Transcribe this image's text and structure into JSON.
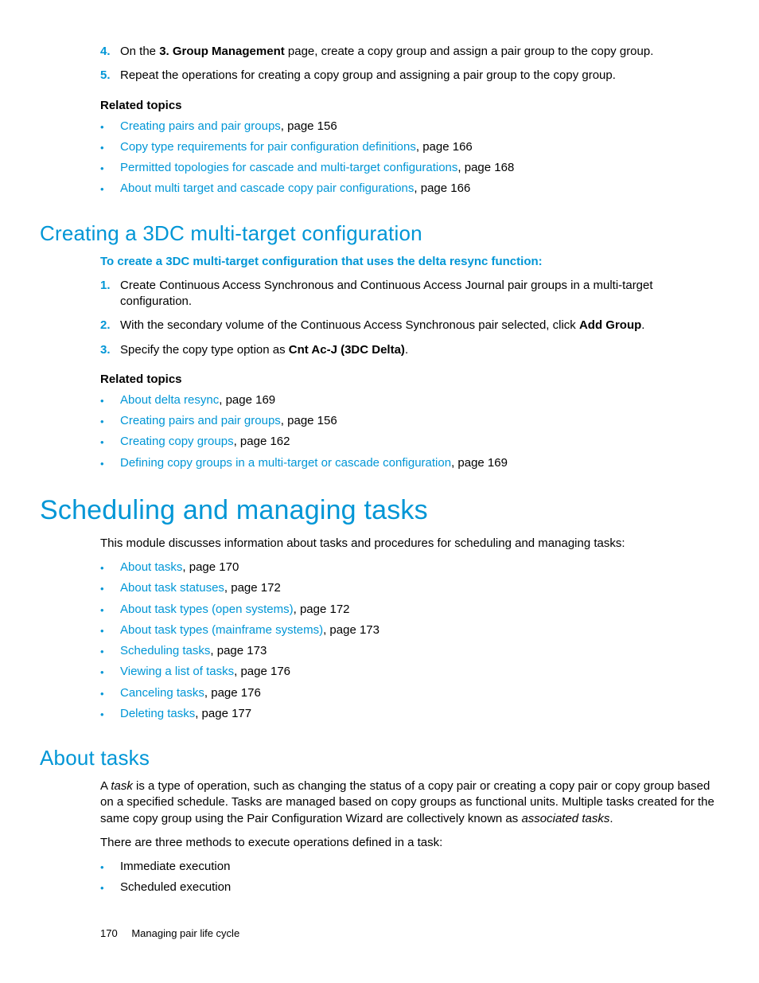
{
  "topSteps": [
    {
      "num": "4.",
      "pre": "On the ",
      "bold": "3. Group Management",
      "post": " page, create a copy group and assign a pair group to the copy group."
    },
    {
      "num": "5.",
      "pre": "Repeat the operations for creating a copy group and assigning a pair group to the copy group.",
      "bold": "",
      "post": ""
    }
  ],
  "related1": {
    "heading": "Related topics",
    "items": [
      {
        "link": "Creating pairs and pair groups",
        "suffix": ", page 156"
      },
      {
        "link": "Copy type requirements for pair configuration definitions",
        "suffix": ", page 166"
      },
      {
        "link": "Permitted topologies for cascade and multi-target configurations",
        "suffix": ", page 168"
      },
      {
        "link": "About multi target and cascade copy pair configurations",
        "suffix": ", page 166"
      }
    ]
  },
  "h2_1": "Creating a 3DC multi-target configuration",
  "intro1": "To create a 3DC multi-target configuration that uses the delta resync function:",
  "steps2": [
    {
      "num": "1.",
      "text": "Create Continuous Access Synchronous and Continuous Access Journal pair groups in a multi-target configuration."
    },
    {
      "num": "2.",
      "pre": "With the secondary volume of the Continuous Access Synchronous pair selected, click ",
      "bold": "Add Group",
      "post": "."
    },
    {
      "num": "3.",
      "pre": "Specify the copy type option as ",
      "bold": "Cnt Ac-J (3DC Delta)",
      "post": "."
    }
  ],
  "related2": {
    "heading": "Related topics",
    "items": [
      {
        "link": "About delta resync",
        "suffix": ", page 169"
      },
      {
        "link": "Creating pairs and pair groups",
        "suffix": ", page 156"
      },
      {
        "link": "Creating copy groups",
        "suffix": ", page 162"
      },
      {
        "link": "Defining copy groups in a multi-target or cascade configuration",
        "suffix": ", page 169"
      }
    ]
  },
  "h1_1": "Scheduling and managing tasks",
  "p_sched": "This module discusses information about tasks and procedures for scheduling and managing tasks:",
  "schedLinks": [
    {
      "link": "About tasks",
      "suffix": ", page 170"
    },
    {
      "link": "About task statuses",
      "suffix": ", page 172"
    },
    {
      "link": "About task types (open systems)",
      "suffix": ", page 172"
    },
    {
      "link": "About task types (mainframe systems)",
      "suffix": ", page 173"
    },
    {
      "link": "Scheduling tasks",
      "suffix": ", page 173"
    },
    {
      "link": "Viewing a list of tasks",
      "suffix": ", page 176"
    },
    {
      "link": "Canceling tasks",
      "suffix": ", page 176"
    },
    {
      "link": "Deleting tasks",
      "suffix": ", page 177"
    }
  ],
  "h2_2": "About tasks",
  "aboutTasks": {
    "p1_a": "A ",
    "p1_i1": "task",
    "p1_b": " is a type of operation, such as changing the status of a copy pair or creating a copy pair or copy group based on a specified schedule. Tasks are managed based on copy groups as functional units. Multiple tasks created for the same copy group using the Pair Configuration Wizard are collectively known as ",
    "p1_i2": "associated tasks",
    "p1_c": ".",
    "p2": "There are three methods to execute operations defined in a task:",
    "methods": [
      "Immediate execution",
      "Scheduled execution"
    ]
  },
  "footer": {
    "num": "170",
    "title": "Managing pair life cycle"
  }
}
